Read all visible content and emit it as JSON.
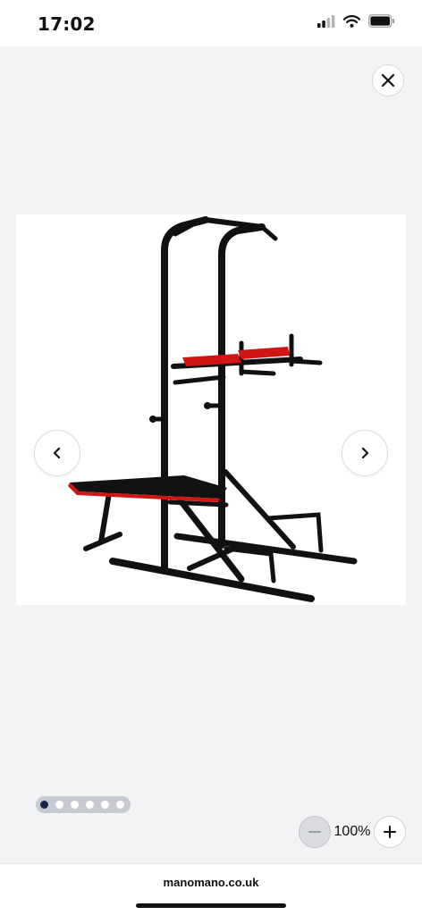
{
  "status_bar": {
    "time": "17:02",
    "battery_level": 0.8
  },
  "viewer": {
    "close_icon": "close-icon",
    "prev_icon": "chevron-left-icon",
    "next_icon": "chevron-right-icon",
    "image_subject": "power tower with pull-up bar, dip station and bench",
    "image_count": 6,
    "active_image": 1
  },
  "zoom": {
    "level": "100%",
    "out_icon": "minus-icon",
    "in_icon": "plus-icon"
  },
  "browser": {
    "url": "manomano.co.uk"
  },
  "colors": {
    "accent_dark": "#1a2447",
    "pad_red": "#d01515",
    "frame_black": "#111111",
    "background": "#f2f3f5"
  }
}
